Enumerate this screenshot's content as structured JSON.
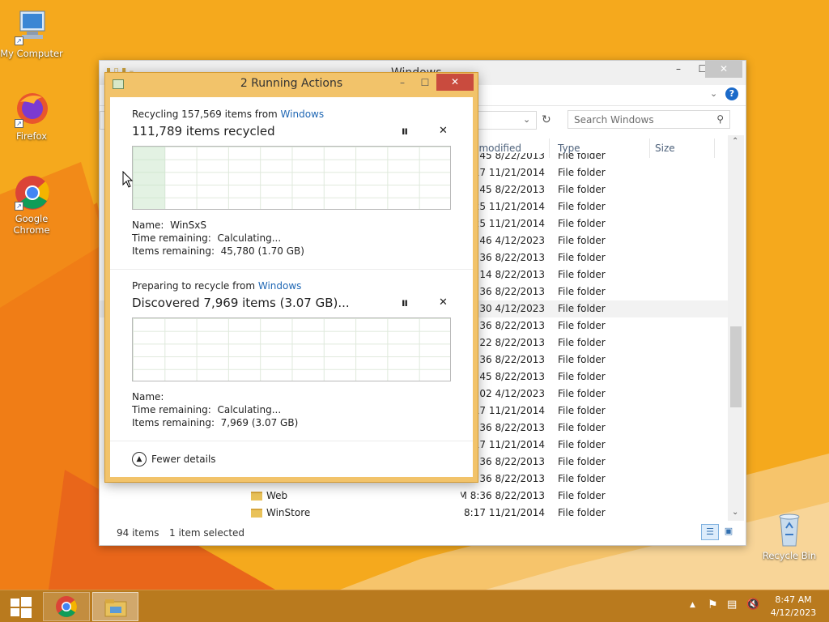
{
  "desktop": {
    "icons": [
      {
        "label": "My Computer"
      },
      {
        "label": "Firefox"
      },
      {
        "label": "Google Chrome"
      },
      {
        "label": "Recycle Bin"
      }
    ]
  },
  "explorer": {
    "title": "Windows",
    "search_placeholder": "Search Windows",
    "columns": {
      "date": "Date modified",
      "type": "Type",
      "size": "Size"
    },
    "rows": [
      {
        "name": "",
        "date": "8/22/2013 7:45 AM",
        "type": "File folder"
      },
      {
        "name": "",
        "date": "11/21/2014 8:17 AM",
        "type": "File folder"
      },
      {
        "name": "",
        "date": "8/22/2013 7:45 AM",
        "type": "File folder"
      },
      {
        "name": "",
        "date": "11/21/2014 12:25 ...",
        "type": "File folder"
      },
      {
        "name": "",
        "date": "11/21/2014 12:25 ...",
        "type": "File folder"
      },
      {
        "name": "",
        "date": "4/12/2023 12:46 PM",
        "type": "File folder"
      },
      {
        "name": "",
        "date": "8/22/2013 8:36 AM",
        "type": "File folder"
      },
      {
        "name": "",
        "date": "8/22/2013 11:14 PM",
        "type": "File folder"
      },
      {
        "name": "",
        "date": "8/22/2013 8:36 AM",
        "type": "File folder"
      },
      {
        "name": "",
        "date": "4/12/2023 8:30 AM",
        "type": "File folder"
      },
      {
        "name": "",
        "date": "8/22/2013 8:36 AM",
        "type": "File folder"
      },
      {
        "name": "",
        "date": "8/22/2013 11:22 PM",
        "type": "File folder"
      },
      {
        "name": "",
        "date": "8/22/2013 8:36 AM",
        "type": "File folder"
      },
      {
        "name": "",
        "date": "8/22/2013 7:45 AM",
        "type": "File folder"
      },
      {
        "name": "",
        "date": "4/12/2023 10:02 AM",
        "type": "File folder"
      },
      {
        "name": "",
        "date": "11/21/2014 8:17 AM",
        "type": "File folder"
      },
      {
        "name": "",
        "date": "8/22/2013 8:36 AM",
        "type": "File folder"
      },
      {
        "name": "",
        "date": "11/21/2014 8:17 AM",
        "type": "File folder"
      },
      {
        "name": "",
        "date": "8/22/2013 8:36 AM",
        "type": "File folder"
      },
      {
        "name": "",
        "date": "8/22/2013 8:36 AM",
        "type": "File folder"
      },
      {
        "name": "Web",
        "date": "8/22/2013 8:36 AM",
        "type": "File folder"
      },
      {
        "name": "WinStore",
        "date": "11/21/2014 8:17 AM",
        "type": "File folder"
      }
    ],
    "status": {
      "items": "94 items",
      "selected": "1 item selected"
    }
  },
  "dialog": {
    "title": "2 Running Actions",
    "op1": {
      "line1_prefix": "Recycling 157,569 items from ",
      "line1_link": "Windows",
      "headline": "111,789 items recycled",
      "name_label": "Name:",
      "name_value": "WinSxS",
      "time_label": "Time remaining:",
      "time_value": "Calculating...",
      "items_label": "Items remaining:",
      "items_value": "45,780 (1.70 GB)"
    },
    "op2": {
      "line1_prefix": "Preparing to recycle from ",
      "line1_link": "Windows",
      "headline": "Discovered 7,969 items (3.07 GB)...",
      "name_label": "Name:",
      "name_value": "",
      "time_label": "Time remaining:",
      "time_value": "Calculating...",
      "items_label": "Items remaining:",
      "items_value": "7,969 (3.07 GB)"
    },
    "fewer_details": "Fewer details"
  },
  "taskbar": {
    "time": "8:47 AM",
    "date": "4/12/2023"
  }
}
